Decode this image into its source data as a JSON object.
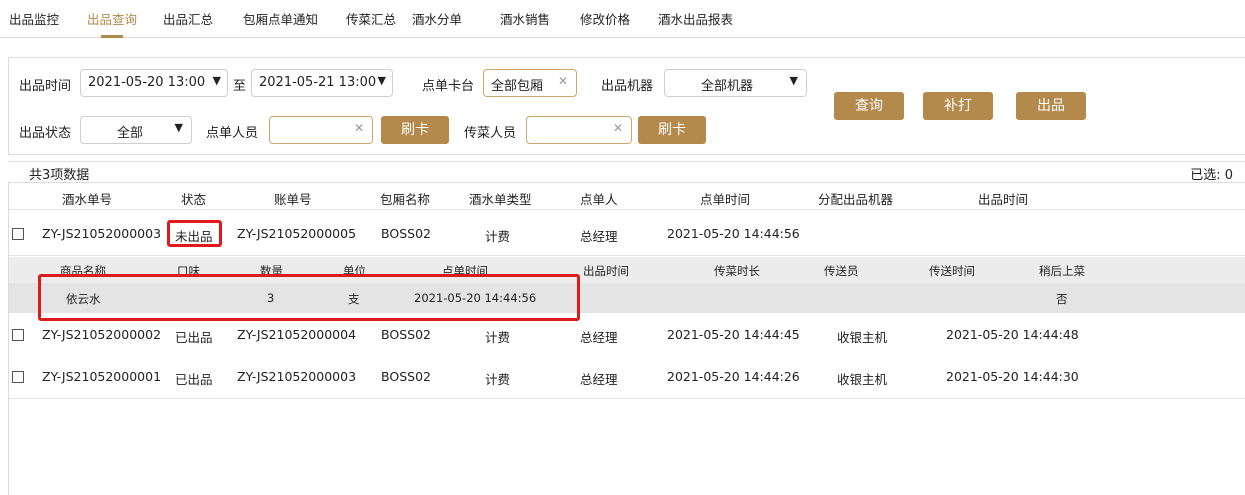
{
  "nav": {
    "tabs": [
      "出品监控",
      "出品查询",
      "出品汇总",
      "包厢点单通知",
      "传菜汇总",
      "酒水分单",
      "酒水销售",
      "修改价格",
      "酒水出品报表"
    ],
    "active_index": 1
  },
  "filters": {
    "time_label": "出品时间",
    "start_time": "2021-05-20 13:00",
    "to_label": "至",
    "end_time": "2021-05-21 13:00",
    "table_label": "点单卡台",
    "table_value": "全部包厢",
    "machine_label": "出品机器",
    "machine_value": "全部机器",
    "status_label": "出品状态",
    "status_value": "全部",
    "orderer_label": "点单人员",
    "orderer_value": "",
    "swipe1": "刷卡",
    "server_label": "传菜人员",
    "server_value": "",
    "swipe2": "刷卡",
    "query": "查询",
    "reprint": "补打",
    "serve": "出品"
  },
  "summary": {
    "count_text": "共3项数据",
    "selected_text": "已选: 0"
  },
  "table": {
    "headers": [
      "酒水单号",
      "状态",
      "账单号",
      "包厢名称",
      "酒水单类型",
      "点单人",
      "点单时间",
      "分配出品机器",
      "出品时间"
    ],
    "rows": [
      {
        "order_no": "ZY-JS21052000003",
        "status": "未出品",
        "bill_no": "ZY-JS21052000005",
        "room": "BOSS02",
        "type": "计费",
        "orderer": "总经理",
        "order_time": "2021-05-20 14:44:56",
        "machine": "",
        "serve_time": ""
      },
      {
        "order_no": "ZY-JS21052000002",
        "status": "已出品",
        "bill_no": "ZY-JS21052000004",
        "room": "BOSS02",
        "type": "计费",
        "orderer": "总经理",
        "order_time": "2021-05-20 14:44:45",
        "machine": "收银主机",
        "serve_time": "2021-05-20 14:44:48"
      },
      {
        "order_no": "ZY-JS21052000001",
        "status": "已出品",
        "bill_no": "ZY-JS21052000003",
        "room": "BOSS02",
        "type": "计费",
        "orderer": "总经理",
        "order_time": "2021-05-20 14:44:26",
        "machine": "收银主机",
        "serve_time": "2021-05-20 14:44:30"
      }
    ],
    "detail": {
      "headers": [
        "商品名称",
        "口味",
        "数量",
        "单位",
        "点单时间",
        "出品时间",
        "传菜时长",
        "传送员",
        "传送时间",
        "稍后上菜"
      ],
      "item": {
        "name": "依云水",
        "flavor": "",
        "qty": "3",
        "unit": "支",
        "order_time": "2021-05-20 14:44:56",
        "serve_time": "",
        "duration": "",
        "runner": "",
        "send_time": "",
        "later": "否"
      }
    }
  },
  "colors": {
    "accent": "#b3894c",
    "highlight": "#e01a1a"
  }
}
